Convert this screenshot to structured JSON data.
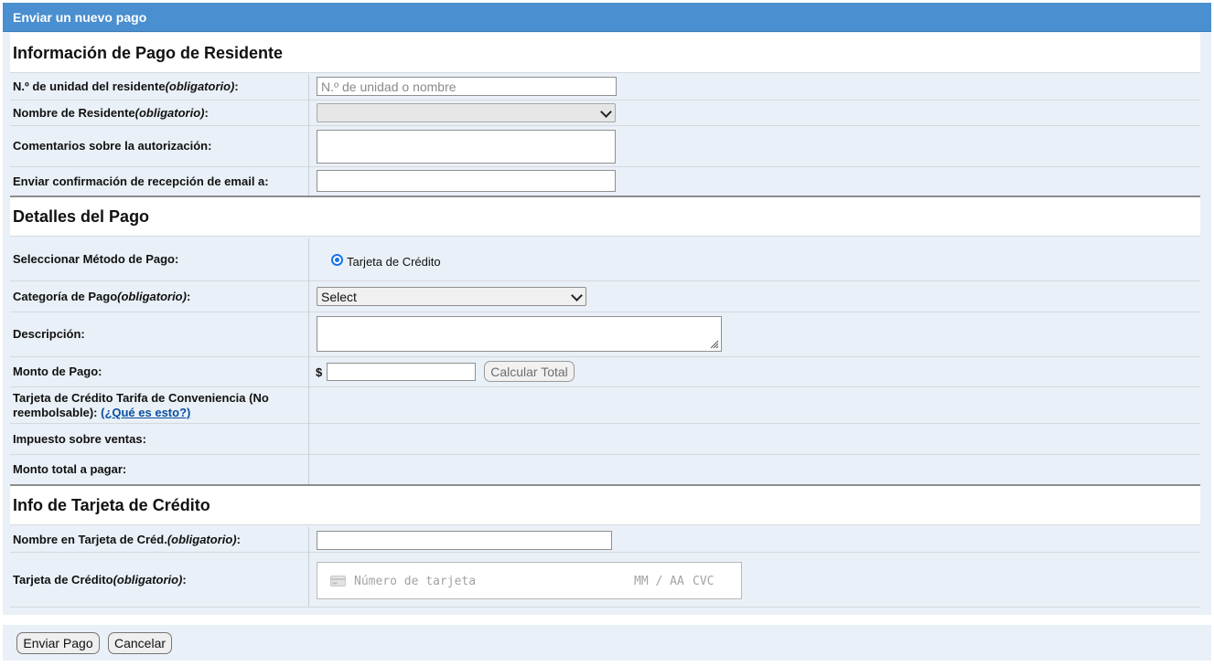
{
  "window": {
    "title": "Enviar un nuevo pago"
  },
  "sections": {
    "resident": {
      "title": "Información de Pago de Residente",
      "unit_label": "N.º de unidad del residente",
      "unit_req": "(obligatorio)",
      "unit_label_end": ":",
      "unit_placeholder": "N.º de unidad o nombre",
      "name_label": "Nombre de Residente",
      "name_req": "(obligatorio)",
      "name_label_end": ":",
      "name_value": "",
      "comments_label": "Comentarios sobre la autorización:",
      "email_label": "Enviar confirmación de recepción de email a:",
      "email_value": ""
    },
    "payment": {
      "title": "Detalles del Pago",
      "method_label": "Seleccionar Método de Pago:",
      "method_option": "Tarjeta de Crédito",
      "method_selected": true,
      "category_label": "Categoría de Pago",
      "category_req": "(obligatorio)",
      "category_label_end": ":",
      "category_value": "Select",
      "description_label": "Descripción:",
      "amount_label": "Monto de Pago:",
      "currency_symbol": "$",
      "calc_button": "Calcular Total",
      "fee_label": "Tarjeta de Crédito Tarifa de Conveniencia (No reembolsable):",
      "fee_link": "(¿Qué es esto?)",
      "tax_label": "Impuesto sobre ventas:",
      "total_label": "Monto total a pagar:"
    },
    "card": {
      "title": "Info de Tarjeta de Crédito",
      "name_label": "Nombre en Tarjeta de Créd.",
      "name_req": "(obligatorio)",
      "name_label_end": ":",
      "card_label": "Tarjeta de Crédito",
      "card_req": "(obligatorio)",
      "card_label_end": ":",
      "card_number_placeholder": "Número de tarjeta",
      "expiry_placeholder": "MM / AA",
      "cvc_placeholder": "CVC"
    }
  },
  "footer": {
    "submit_button": "Enviar Pago",
    "cancel_button": "Cancelar"
  },
  "colors": {
    "titlebar": "#4a8fcf",
    "panel": "#e9f0f7",
    "link": "#0b4fa0",
    "radio": "#1a73e8"
  }
}
